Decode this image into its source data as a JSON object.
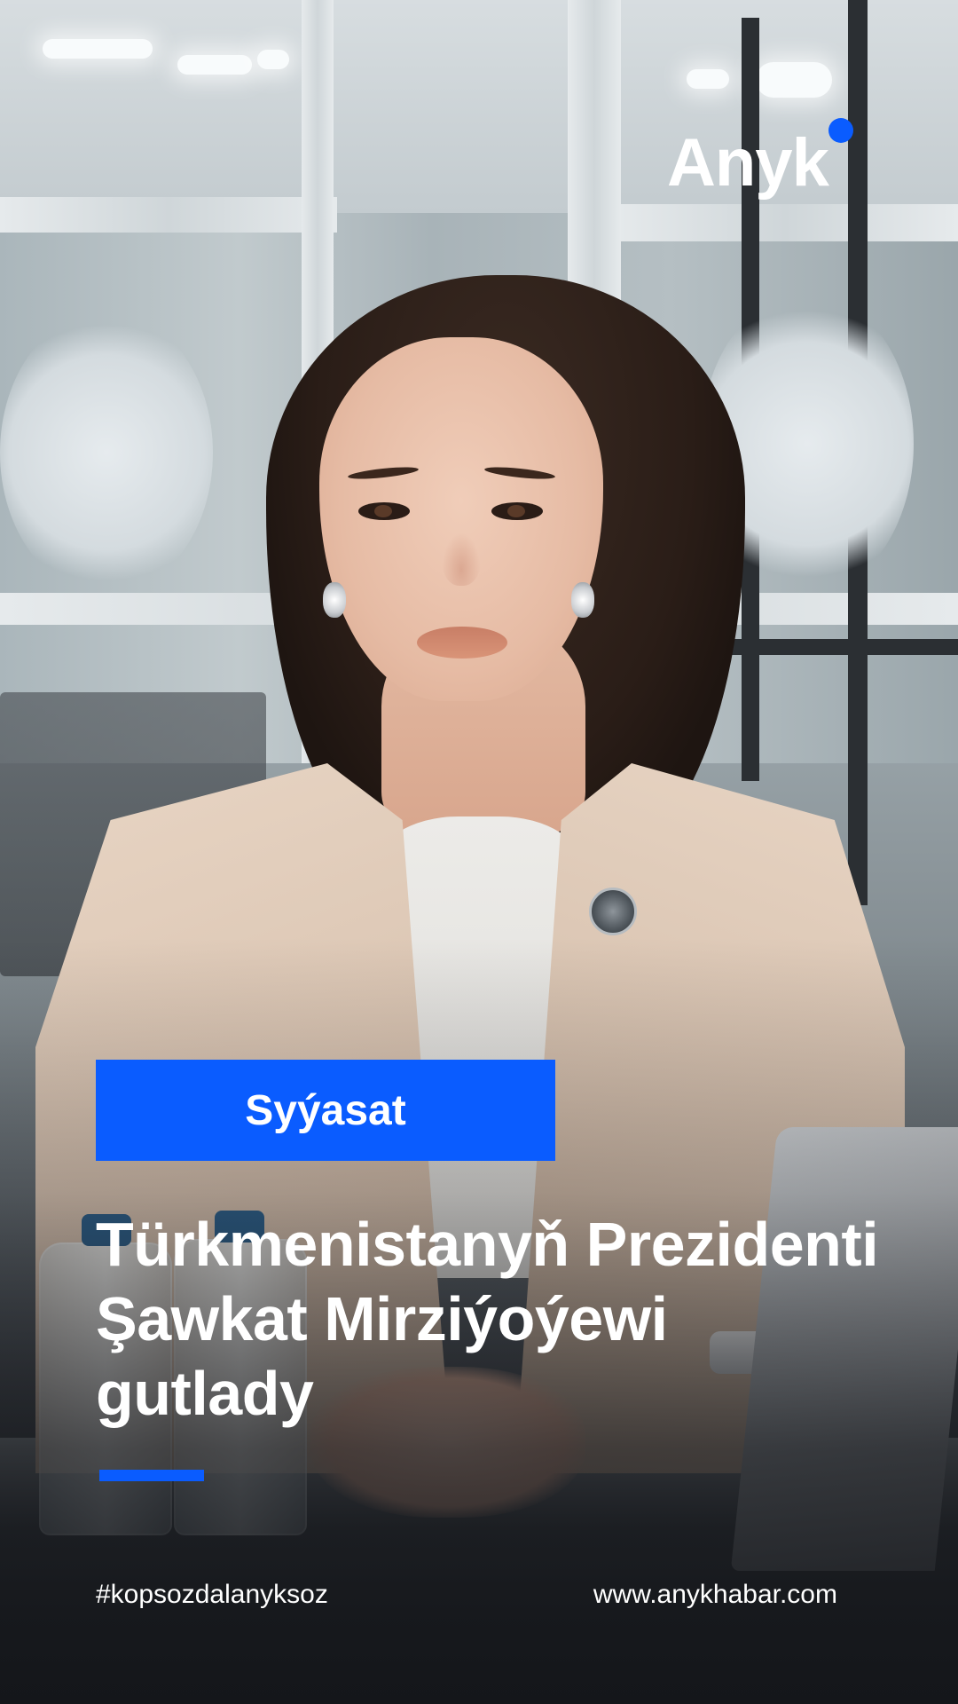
{
  "brand": {
    "logo_text": "Anyk",
    "logo_dot_color": "#0a5cff",
    "accent_color": "#0a5cff"
  },
  "post": {
    "category": "Syýasat",
    "headline_lines": [
      "Türkmenistanyň Prezidenti",
      "Şawkat Mirziýoýewi",
      "gutlady"
    ]
  },
  "footer": {
    "hashtag": "#kopsozdalanyksoz",
    "website": "www.anykhabar.com"
  },
  "scene": {
    "icons": [
      "lapel-pin-icon",
      "earring-icon",
      "water-bottle-icon",
      "laptop-icon"
    ]
  }
}
